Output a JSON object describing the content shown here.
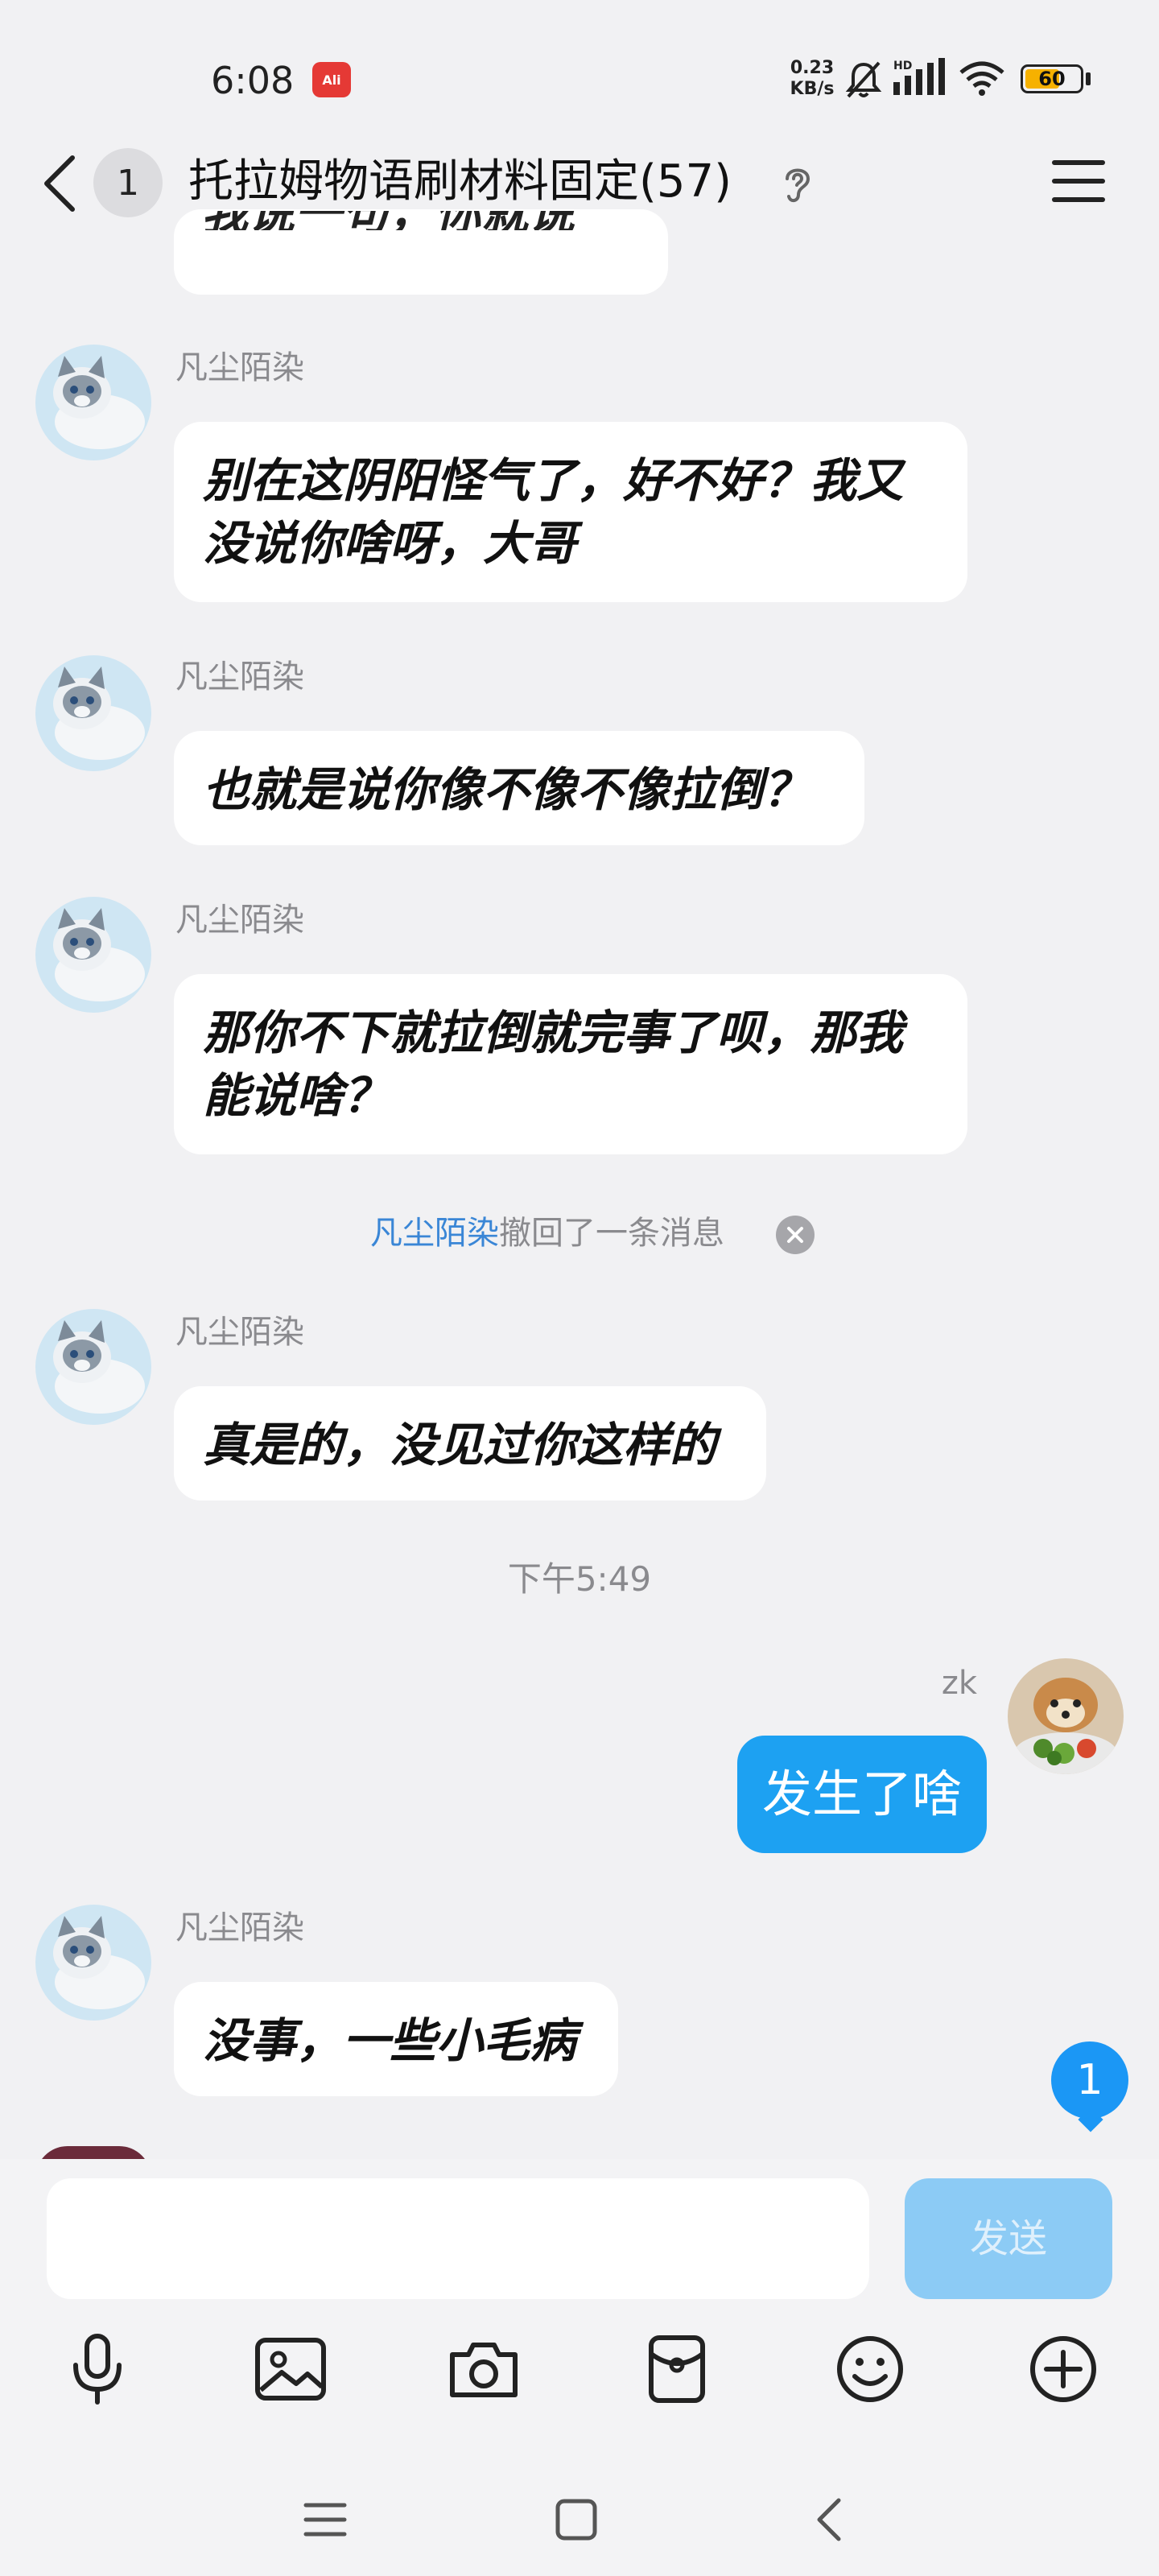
{
  "status": {
    "time": "6:08",
    "app_badge": "Ali",
    "net_speed_value": "0.23",
    "net_speed_unit": "KB/s",
    "signal_label": "HD",
    "battery": "60"
  },
  "header": {
    "unread_count": "1",
    "title": "托拉姆物语刷材料固定(57)"
  },
  "messages": [
    {
      "sender": "凡尘陌染",
      "text": "别在这阴阳怪气了，好不好？我又没说你啥呀，大哥"
    },
    {
      "sender": "凡尘陌染",
      "text": "也就是说你像不像不像拉倒？"
    },
    {
      "sender": "凡尘陌染",
      "text": "那你不下就拉倒就完事了呗，那我能说啥？"
    },
    {
      "sender": "凡尘陌染",
      "text": "真是的，没见过你这样的"
    },
    {
      "sender": "凡尘陌染",
      "text": "没事，一些小毛病"
    }
  ],
  "partial_message_text": "我说一句，你就说",
  "recall": {
    "name": "凡尘陌染",
    "text": "撤回了一条消息"
  },
  "time_divider": "下午5:49",
  "my_message": {
    "sender": "zk",
    "text": "发生了啥"
  },
  "new_message_badge": "1",
  "input": {
    "placeholder": "",
    "send_label": "发送"
  },
  "toolbar_icons": [
    "microphone-icon",
    "image-icon",
    "camera-icon",
    "red-packet-icon",
    "emoji-icon",
    "plus-icon"
  ],
  "colors": {
    "accent": "#1da1f2",
    "send_disabled": "#8ccbf5",
    "recall_name": "#3a86d6",
    "background": "#f1f1f3"
  }
}
